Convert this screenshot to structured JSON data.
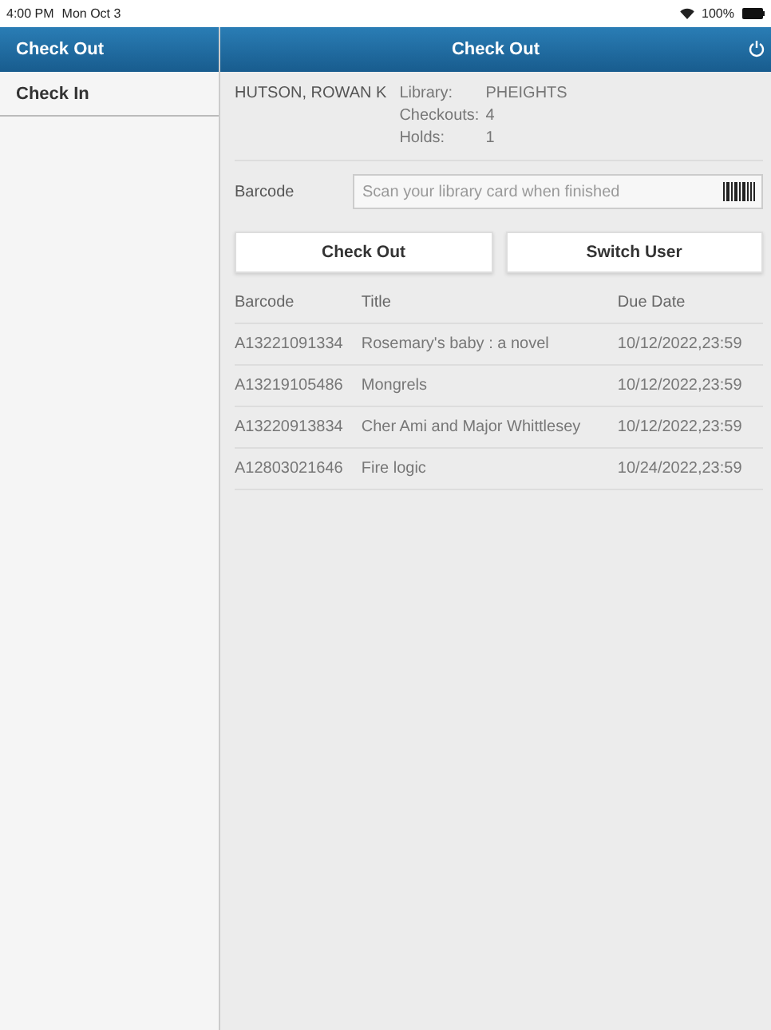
{
  "status_bar": {
    "time": "4:00 PM",
    "date": "Mon Oct 3",
    "battery": "100%"
  },
  "sidebar": {
    "items": [
      {
        "label": "Check Out",
        "selected": true
      },
      {
        "label": "Check In",
        "selected": false
      }
    ]
  },
  "header": {
    "title": "Check Out"
  },
  "patron": {
    "name": "HUTSON, ROWAN K",
    "details": [
      {
        "label": "Library:",
        "value": "PHEIGHTS"
      },
      {
        "label": "Checkouts:",
        "value": "4"
      },
      {
        "label": "Holds:",
        "value": "1"
      }
    ]
  },
  "barcode_field": {
    "label": "Barcode",
    "placeholder": "Scan your library card when finished"
  },
  "buttons": [
    "Check Out",
    "Switch User"
  ],
  "table": {
    "columns": [
      "Barcode",
      "Title",
      "Due Date"
    ],
    "rows": [
      [
        "A13221091334",
        "Rosemary's baby : a novel",
        "10/12/2022,23:59"
      ],
      [
        "A13219105486",
        "Mongrels",
        "10/12/2022,23:59"
      ],
      [
        "A13220913834",
        "Cher Ami and Major Whittlesey",
        "10/12/2022,23:59"
      ],
      [
        "A12803021646",
        "Fire logic",
        "10/24/2022,23:59"
      ]
    ]
  }
}
